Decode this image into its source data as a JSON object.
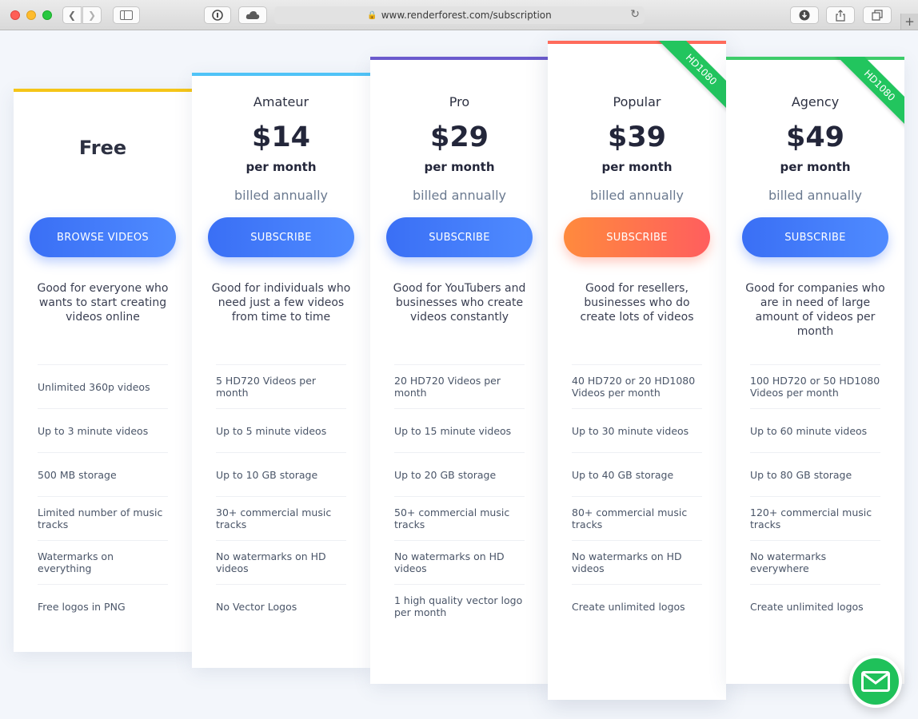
{
  "browser": {
    "url": "www.renderforest.com/subscription"
  },
  "plans": [
    {
      "title": "Free",
      "cta": "BROWSE VIDEOS",
      "description": "Good for everyone who wants to start creating videos online",
      "features": [
        "Unlimited 360p videos",
        "Up to 3 minute videos",
        "500 MB storage",
        "Limited number of music tracks",
        "Watermarks on everything",
        "Free logos in PNG"
      ],
      "accent": "#f5c518"
    },
    {
      "name": "Amateur",
      "price": "$14",
      "period": "per month",
      "billing": "billed annually",
      "cta": "SUBSCRIBE",
      "description": "Good for individuals who need just a few videos from time to time",
      "features": [
        "5  HD720  Videos per month",
        "Up to 5 minute videos",
        "Up to 10 GB storage",
        "30+ commercial music tracks",
        "No watermarks on HD videos",
        "No Vector Logos"
      ],
      "accent": "#4fc3f7"
    },
    {
      "name": "Pro",
      "price": "$29",
      "period": "per month",
      "billing": "billed annually",
      "cta": "SUBSCRIBE",
      "description": "Good for YouTubers and businesses who create videos constantly",
      "features": [
        "20  HD720  Videos per month",
        "Up to 15 minute videos",
        "Up to 20 GB storage",
        "50+ commercial music tracks",
        "No watermarks on HD videos",
        "1 high quality vector logo per month"
      ],
      "accent": "#6a5acd"
    },
    {
      "name": "Popular",
      "price": "$39",
      "period": "per month",
      "billing": "billed annually",
      "cta": "SUBSCRIBE",
      "badge": "HD1080",
      "description": "Good for resellers, businesses who do create lots of videos",
      "features": [
        "40 HD720  or  20 HD1080 Videos per month",
        "Up to 30 minute videos",
        "Up to 40 GB storage",
        "80+ commercial music tracks",
        "No watermarks on HD videos",
        "Create unlimited logos"
      ],
      "accent": "#ff6b5b"
    },
    {
      "name": "Agency",
      "price": "$49",
      "period": "per month",
      "billing": "billed annually",
      "cta": "SUBSCRIBE",
      "badge": "HD1080",
      "description": "Good for companies who are in need of large amount of videos per month",
      "features": [
        "100 HD720  or  50 HD1080 Videos per month",
        "Up to 60 minute videos",
        "Up to 80 GB storage",
        "120+ commercial music tracks",
        "No watermarks everywhere",
        "Create unlimited logos"
      ],
      "accent": "#3dcc6a"
    }
  ],
  "colors": {
    "primary_button": "#3a6ff5",
    "popular_button": "#ff7a45",
    "ribbon": "#22c55e",
    "chat": "#1fc15a"
  },
  "icons": {
    "chat": "envelope-icon"
  }
}
